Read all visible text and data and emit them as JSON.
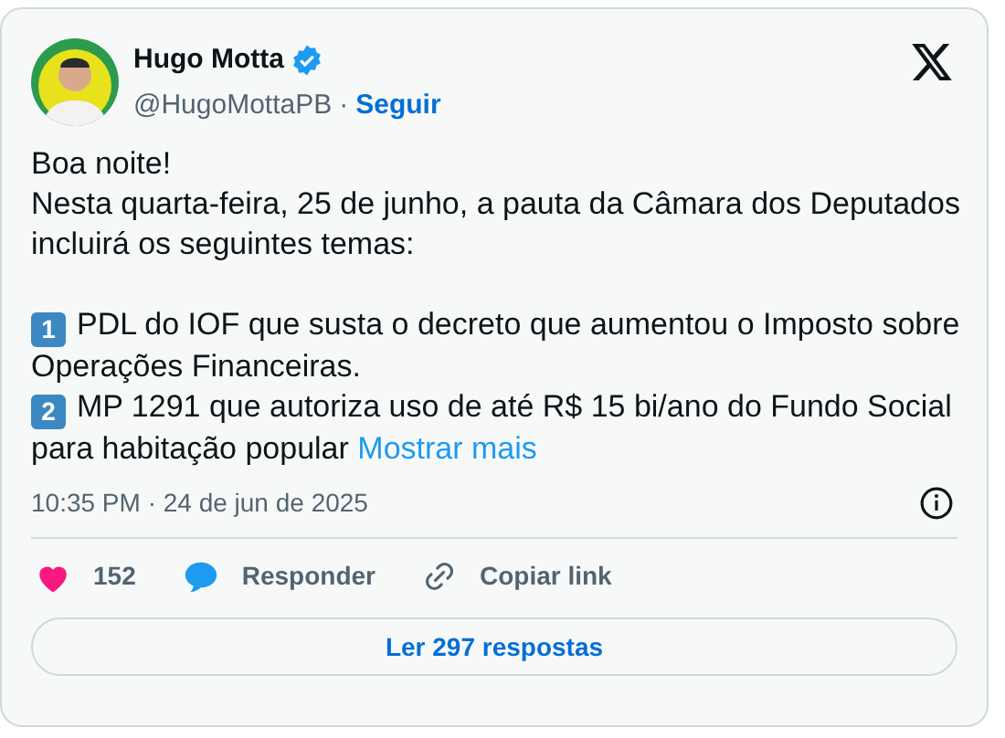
{
  "author": {
    "name": "Hugo Motta",
    "verified": true,
    "handle": "@HugoMottaPB",
    "separator": "·",
    "follow": "Seguir"
  },
  "body": {
    "paragraphs": [
      "Boa noite!",
      "Nesta quarta-feira, 25 de junho, a pauta da Câmara dos Deputados incluirá os seguintes temas:"
    ],
    "items": [
      {
        "number": "1",
        "text": "PDL do IOF que susta o decreto que aumentou o Imposto sobre Operações Financeiras."
      },
      {
        "number": "2",
        "text": "MP 1291 que autoriza uso de até R$ 15 bi/ano do Fundo Social para habitação popular"
      }
    ],
    "more": "Mostrar mais"
  },
  "timestamp": "10:35 PM · 24 de jun de 2025",
  "actions": [
    {
      "kind": "like",
      "label": "152"
    },
    {
      "kind": "reply",
      "label": "Responder"
    },
    {
      "kind": "copy",
      "label": "Copiar link"
    }
  ],
  "replies_button": "Ler 297 respostas"
}
